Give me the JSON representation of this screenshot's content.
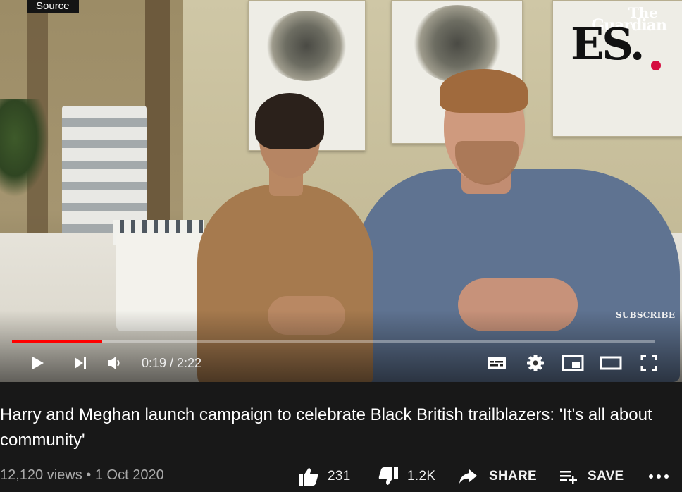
{
  "overlay": {
    "source_label": "Source",
    "logo_the": "The",
    "logo_guardian": "Guardian",
    "logo_es": "ES.",
    "subscribe_watermark": "SUBSCRIBE"
  },
  "player": {
    "progress_fraction": 0.14,
    "current_time": "0:19",
    "duration": "2:22",
    "time_display": "0:19 / 2:22",
    "accent_color": "#ff0000"
  },
  "video": {
    "title": "Harry and Meghan launch campaign to celebrate Black British trailblazers: 'It's all about community'",
    "meta": "12,120 views • 1 Oct 2020"
  },
  "actions": {
    "likes": "231",
    "dislikes": "1.2K",
    "share": "SHARE",
    "save": "SAVE"
  }
}
